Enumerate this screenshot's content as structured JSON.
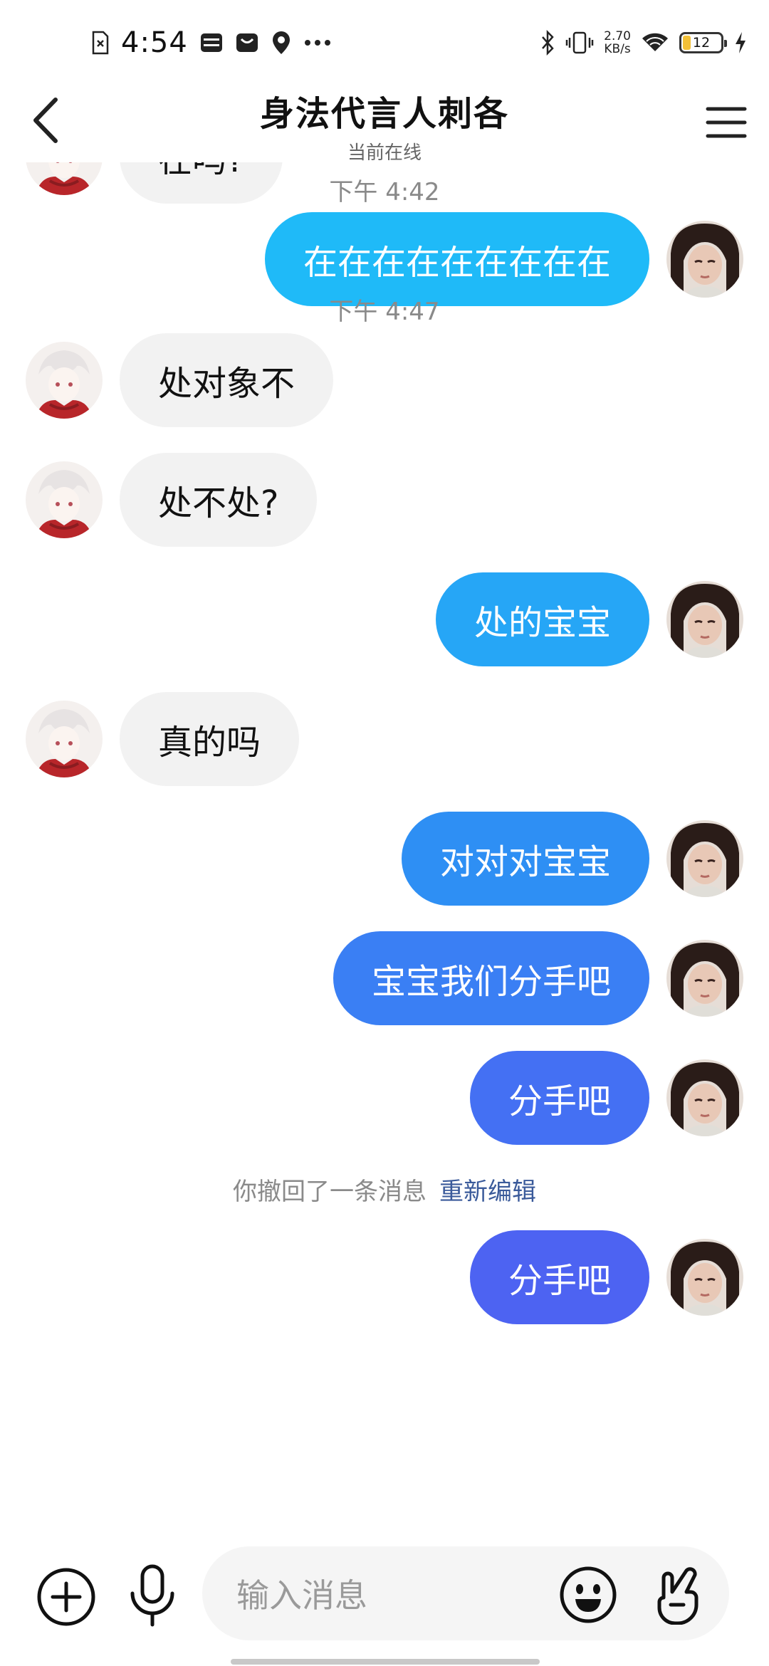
{
  "status_bar": {
    "time": "4:54",
    "net_speed_value": "2.70",
    "net_speed_unit": "KB/s",
    "battery": "12",
    "icons": [
      "sim-card-icon",
      "wallet-icon",
      "mail-icon",
      "location-pin-icon",
      "more-dots-icon",
      "bluetooth-icon",
      "vibrate-icon",
      "wifi-icon",
      "battery-icon",
      "charging-icon"
    ]
  },
  "header": {
    "title": "身法代言人刺各",
    "subtitle": "当前在线",
    "back_icon": "chevron-left-icon",
    "menu_icon": "hamburger-menu-icon"
  },
  "colors": {
    "incoming_bubble": "#f2f2f2",
    "outgoing_gradient": [
      "#1fbaf8",
      "#26a6f6",
      "#2e8ff4",
      "#3a7ff4",
      "#4470f3",
      "#4d63f2"
    ],
    "timestamp": "#8a8a8a",
    "reedit_link": "#3a5a9a"
  },
  "messages": [
    {
      "from": "other",
      "text": "在吗?"
    },
    {
      "type": "time",
      "text": "下午 4:42"
    },
    {
      "from": "me",
      "text": "在在在在在在在在在"
    },
    {
      "type": "time",
      "text": "下午 4:47"
    },
    {
      "from": "other",
      "text": "处对象不"
    },
    {
      "from": "other",
      "text": "处不处?"
    },
    {
      "from": "me",
      "text": "处的宝宝"
    },
    {
      "from": "other",
      "text": "真的吗"
    },
    {
      "from": "me",
      "text": "对对对宝宝"
    },
    {
      "from": "me",
      "text": "宝宝我们分手吧"
    },
    {
      "from": "me",
      "text": "分手吧"
    },
    {
      "type": "recall",
      "text": "你撤回了一条消息",
      "action": "重新编辑"
    },
    {
      "from": "me",
      "text": "分手吧"
    }
  ],
  "input_bar": {
    "placeholder": "输入消息",
    "icons": [
      "plus-circle-icon",
      "microphone-icon",
      "emoji-icon",
      "finger-heart-icon"
    ]
  }
}
